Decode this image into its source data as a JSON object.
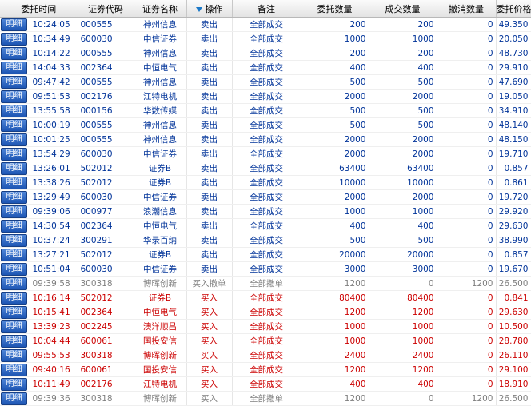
{
  "columns": {
    "time": "委托时间",
    "code": "证券代码",
    "name": "证券名称",
    "op": "操作",
    "note": "备注",
    "qty": "委托数量",
    "deal": "成交数量",
    "cancel": "撤消数量",
    "price": "委托价格"
  },
  "detail_label": "明细",
  "icons": {
    "sort": "sort-desc-icon"
  },
  "colors": {
    "sell": "#003399",
    "buy": "#cc0000",
    "cancelled": "#7f7f7f",
    "button": "#2a63c4"
  },
  "rows": [
    {
      "type": "sell",
      "time": "10:24:05",
      "code": "000555",
      "name": "神州信息",
      "op": "卖出",
      "note": "全部成交",
      "qty": "200",
      "deal": "200",
      "cancel": "0",
      "price": "49.350"
    },
    {
      "type": "sell",
      "time": "10:34:49",
      "code": "600030",
      "name": "中信证券",
      "op": "卖出",
      "note": "全部成交",
      "qty": "1000",
      "deal": "1000",
      "cancel": "0",
      "price": "20.050"
    },
    {
      "type": "sell",
      "time": "10:14:22",
      "code": "000555",
      "name": "神州信息",
      "op": "卖出",
      "note": "全部成交",
      "qty": "200",
      "deal": "200",
      "cancel": "0",
      "price": "48.730"
    },
    {
      "type": "sell",
      "time": "14:04:33",
      "code": "002364",
      "name": "中恒电气",
      "op": "卖出",
      "note": "全部成交",
      "qty": "400",
      "deal": "400",
      "cancel": "0",
      "price": "29.910"
    },
    {
      "type": "sell",
      "time": "09:47:42",
      "code": "000555",
      "name": "神州信息",
      "op": "卖出",
      "note": "全部成交",
      "qty": "500",
      "deal": "500",
      "cancel": "0",
      "price": "47.690"
    },
    {
      "type": "sell",
      "time": "09:51:53",
      "code": "002176",
      "name": "江特电机",
      "op": "卖出",
      "note": "全部成交",
      "qty": "2000",
      "deal": "2000",
      "cancel": "0",
      "price": "19.050"
    },
    {
      "type": "sell",
      "time": "13:55:58",
      "code": "000156",
      "name": "华数传媒",
      "op": "卖出",
      "note": "全部成交",
      "qty": "500",
      "deal": "500",
      "cancel": "0",
      "price": "34.910"
    },
    {
      "type": "sell",
      "time": "10:00:19",
      "code": "000555",
      "name": "神州信息",
      "op": "卖出",
      "note": "全部成交",
      "qty": "500",
      "deal": "500",
      "cancel": "0",
      "price": "48.140"
    },
    {
      "type": "sell",
      "time": "10:01:25",
      "code": "000555",
      "name": "神州信息",
      "op": "卖出",
      "note": "全部成交",
      "qty": "2000",
      "deal": "2000",
      "cancel": "0",
      "price": "48.150"
    },
    {
      "type": "sell",
      "time": "13:54:29",
      "code": "600030",
      "name": "中信证券",
      "op": "卖出",
      "note": "全部成交",
      "qty": "2000",
      "deal": "2000",
      "cancel": "0",
      "price": "19.710"
    },
    {
      "type": "sell",
      "time": "13:26:01",
      "code": "502012",
      "name": "证券B",
      "op": "卖出",
      "note": "全部成交",
      "qty": "63400",
      "deal": "63400",
      "cancel": "0",
      "price": "0.857"
    },
    {
      "type": "sell",
      "time": "13:38:26",
      "code": "502012",
      "name": "证券B",
      "op": "卖出",
      "note": "全部成交",
      "qty": "10000",
      "deal": "10000",
      "cancel": "0",
      "price": "0.861"
    },
    {
      "type": "sell",
      "time": "13:29:49",
      "code": "600030",
      "name": "中信证券",
      "op": "卖出",
      "note": "全部成交",
      "qty": "2000",
      "deal": "2000",
      "cancel": "0",
      "price": "19.720"
    },
    {
      "type": "sell",
      "time": "09:39:06",
      "code": "000977",
      "name": "浪潮信息",
      "op": "卖出",
      "note": "全部成交",
      "qty": "1000",
      "deal": "1000",
      "cancel": "0",
      "price": "29.920"
    },
    {
      "type": "sell",
      "time": "14:30:54",
      "code": "002364",
      "name": "中恒电气",
      "op": "卖出",
      "note": "全部成交",
      "qty": "400",
      "deal": "400",
      "cancel": "0",
      "price": "29.630"
    },
    {
      "type": "sell",
      "time": "10:37:24",
      "code": "300291",
      "name": "华录百纳",
      "op": "卖出",
      "note": "全部成交",
      "qty": "500",
      "deal": "500",
      "cancel": "0",
      "price": "38.990"
    },
    {
      "type": "sell",
      "time": "13:27:21",
      "code": "502012",
      "name": "证券B",
      "op": "卖出",
      "note": "全部成交",
      "qty": "20000",
      "deal": "20000",
      "cancel": "0",
      "price": "0.857"
    },
    {
      "type": "sell",
      "time": "10:51:04",
      "code": "600030",
      "name": "中信证券",
      "op": "卖出",
      "note": "全部成交",
      "qty": "3000",
      "deal": "3000",
      "cancel": "0",
      "price": "19.670"
    },
    {
      "type": "cancel",
      "time": "09:39:58",
      "code": "300318",
      "name": "博晖创新",
      "op": "买入撤单",
      "note": "全部撤单",
      "qty": "1200",
      "deal": "0",
      "cancel": "1200",
      "price": "26.500"
    },
    {
      "type": "buy",
      "time": "10:16:14",
      "code": "502012",
      "name": "证券B",
      "op": "买入",
      "note": "全部成交",
      "qty": "80400",
      "deal": "80400",
      "cancel": "0",
      "price": "0.841"
    },
    {
      "type": "buy",
      "time": "10:15:41",
      "code": "002364",
      "name": "中恒电气",
      "op": "买入",
      "note": "全部成交",
      "qty": "1200",
      "deal": "1200",
      "cancel": "0",
      "price": "29.630"
    },
    {
      "type": "buy",
      "time": "13:39:23",
      "code": "002245",
      "name": "澳洋顺昌",
      "op": "买入",
      "note": "全部成交",
      "qty": "1000",
      "deal": "1000",
      "cancel": "0",
      "price": "10.500"
    },
    {
      "type": "buy",
      "time": "10:04:44",
      "code": "600061",
      "name": "国投安信",
      "op": "买入",
      "note": "全部成交",
      "qty": "1000",
      "deal": "1000",
      "cancel": "0",
      "price": "28.780"
    },
    {
      "type": "buy",
      "time": "09:55:53",
      "code": "300318",
      "name": "博晖创新",
      "op": "买入",
      "note": "全部成交",
      "qty": "2400",
      "deal": "2400",
      "cancel": "0",
      "price": "26.110"
    },
    {
      "type": "buy",
      "time": "09:40:16",
      "code": "600061",
      "name": "国投安信",
      "op": "买入",
      "note": "全部成交",
      "qty": "1200",
      "deal": "1200",
      "cancel": "0",
      "price": "29.100"
    },
    {
      "type": "buy",
      "time": "10:11:49",
      "code": "002176",
      "name": "江特电机",
      "op": "买入",
      "note": "全部成交",
      "qty": "400",
      "deal": "400",
      "cancel": "0",
      "price": "18.910"
    },
    {
      "type": "cancel",
      "time": "09:39:36",
      "code": "300318",
      "name": "博晖创新",
      "op": "买入",
      "note": "全部撤单",
      "qty": "1200",
      "deal": "0",
      "cancel": "1200",
      "price": "26.500"
    }
  ]
}
